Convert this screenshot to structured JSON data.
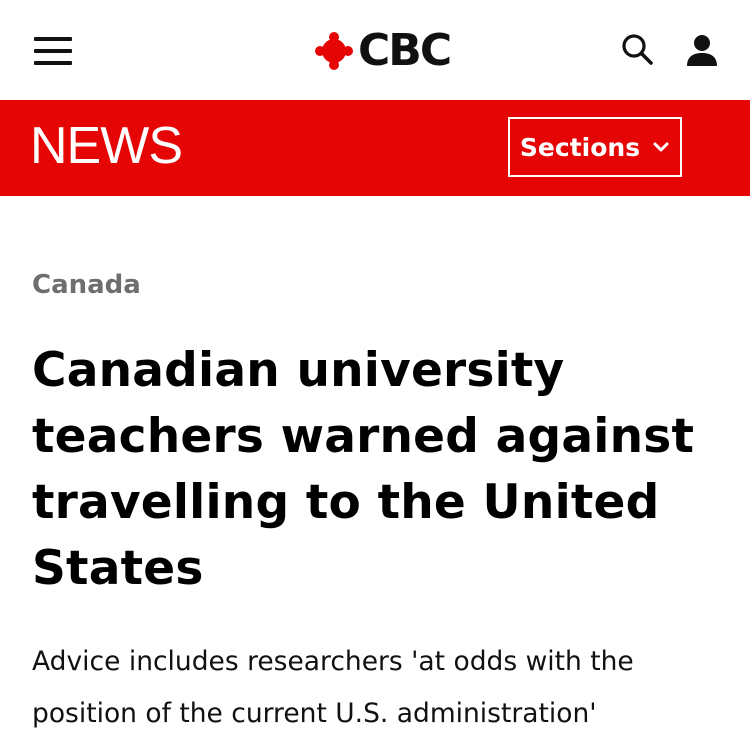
{
  "header": {
    "menu_icon": "hamburger-menu-icon",
    "logo_text": "CBC",
    "logo_icon": "cbc-gem-icon",
    "search_icon": "search-icon",
    "account_icon": "account-icon"
  },
  "newsbar": {
    "label": "NEWS",
    "sections_label": "Sections",
    "sections_icon": "chevron-down-icon",
    "background_color": "#e60505"
  },
  "article": {
    "category": "Canada",
    "headline": "Canadian university teachers warned against travelling to the United States",
    "dek": "Advice includes researchers 'at odds with the position of the current U.S. administration'"
  },
  "colors": {
    "brand_red": "#e60505",
    "category_gray": "#6e6e6e"
  }
}
